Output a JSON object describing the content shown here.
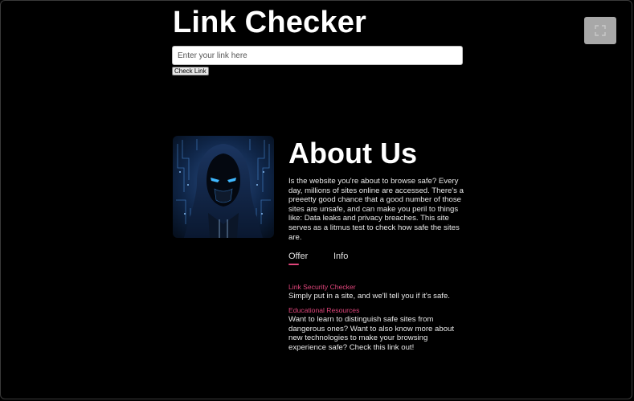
{
  "header": {
    "title": "Link Checker"
  },
  "search": {
    "placeholder": "Enter your link here",
    "value": "",
    "button_label": "Check Link"
  },
  "about": {
    "title": "About Us",
    "text": "Is the website you're about to browse safe? Every day, millions of sites online are accessed. There's a preeetty good chance that a good number of those sites are unsafe, and can make you peril to things like: Data leaks and privacy breaches. This site serves as a litmus test to check how safe the sites are."
  },
  "tabs": [
    {
      "label": "Offer",
      "active": true
    },
    {
      "label": "Info",
      "active": false
    }
  ],
  "offer_items": [
    {
      "title": "Link Security Checker",
      "description": "Simply put in a site, and we'll tell you if it's safe."
    },
    {
      "title": "Educational Resources",
      "description": "Want to learn to distinguish safe sites from dangerous ones? Want to also know more about new technologies to make your browsing experience safe? Check this link out!"
    }
  ],
  "colors": {
    "background": "#000000",
    "accent": "#e0457b",
    "text": "#ffffff",
    "corner_button": "#a8a8a8"
  },
  "icons": {
    "corner_button": "expand-icon",
    "hero": "hooded-hacker-image"
  }
}
